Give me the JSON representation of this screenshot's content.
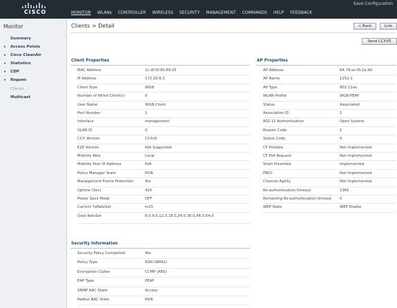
{
  "header": {
    "logo_text": "CISCO",
    "save_config": "Save Configuration",
    "nav": [
      "MONITOR",
      "WLANs",
      "CONTROLLER",
      "WIRELESS",
      "SECURITY",
      "MANAGEMENT",
      "COMMANDS",
      "HELP",
      "FEEDBACK"
    ]
  },
  "sidebar": {
    "title": "Monitor",
    "items": [
      {
        "label": "Summary",
        "arrow": ""
      },
      {
        "label": "Access Points",
        "arrow": "▸"
      },
      {
        "label": "Cisco CleanAir",
        "arrow": "▸"
      },
      {
        "label": "Statistics",
        "arrow": "▸"
      },
      {
        "label": "CDP",
        "arrow": "▸"
      },
      {
        "label": "Rogues",
        "arrow": "▸"
      },
      {
        "label": "Clients",
        "arrow": ""
      },
      {
        "label": "Multicast",
        "arrow": ""
      }
    ]
  },
  "page": {
    "breadcrumb": "Clients > Detail",
    "back_label": "< Back",
    "link_label": "Link",
    "send_label": "Send CCXV5"
  },
  "client": {
    "title": "Client Properties",
    "rows": [
      {
        "k": "MAC Address",
        "v": "1c:df:0f:95:89:25"
      },
      {
        "k": "IP Address",
        "v": "172.20.6.3"
      },
      {
        "k": "Client Type",
        "v": "WGB"
      },
      {
        "k": "Number of Wired Client(s)",
        "v": "0"
      },
      {
        "k": "User Name",
        "v": "WGB-Client"
      },
      {
        "k": "Port Number",
        "v": "1"
      },
      {
        "k": "Interface",
        "v": "management"
      },
      {
        "k": "VLAN ID",
        "v": "0"
      },
      {
        "k": "CCX Version",
        "v": "CCXv5"
      },
      {
        "k": "E2E Version",
        "v": "Not Supported"
      },
      {
        "k": "Mobility Role",
        "v": "Local"
      },
      {
        "k": "Mobility Peer IP Address",
        "v": "N/A"
      },
      {
        "k": "Policy Manager State",
        "v": "RUN"
      },
      {
        "k": "Management Frame Protection",
        "v": "Yes"
      },
      {
        "k": "Uptime (Sec)",
        "v": "420"
      },
      {
        "k": "Power Save Mode",
        "v": "OFF"
      },
      {
        "k": "Current TxRateSet",
        "v": "m15"
      },
      {
        "k": "Data RateSet",
        "v": "6.0,9.0,12.0,18.0,24.0,36.0,48.0,54.0"
      }
    ]
  },
  "ap": {
    "title": "AP Properties",
    "rows": [
      {
        "k": "AP Address",
        "v": "64:79:ac:f0:2a:90"
      },
      {
        "k": "AP Name",
        "v": "1252-1"
      },
      {
        "k": "AP Type",
        "v": "802.11an"
      },
      {
        "k": "WLAN Profile",
        "v": "WGB-PEAP"
      },
      {
        "k": "Status",
        "v": "Associated"
      },
      {
        "k": "Association ID",
        "v": "1"
      },
      {
        "k": "802.11 Authentication",
        "v": "Open System"
      },
      {
        "k": "Reason Code",
        "v": "1"
      },
      {
        "k": "Status Code",
        "v": "0"
      },
      {
        "k": "CF Pollable",
        "v": "Not Implemented"
      },
      {
        "k": "CF Poll Request",
        "v": "Not Implemented"
      },
      {
        "k": "Short Preamble",
        "v": "Implemented"
      },
      {
        "k": "PBCC",
        "v": "Not Implemented"
      },
      {
        "k": "Channel Agility",
        "v": "Not Implemented"
      },
      {
        "k": "Re-authentication timeout",
        "v": "1365"
      },
      {
        "k": "Remaining Re-authentication timeout",
        "v": "0"
      },
      {
        "k": "WEP State",
        "v": "WEP Enable"
      }
    ]
  },
  "security": {
    "title": "Security Information",
    "rows": [
      {
        "k": "Security Policy Completed",
        "v": "Yes"
      },
      {
        "k": "Policy Type",
        "v": "RSN (WPA2)"
      },
      {
        "k": "Encryption Cipher",
        "v": "CCMP (AES)"
      },
      {
        "k": "EAP Type",
        "v": "PEAP"
      },
      {
        "k": "SNMP NAC State",
        "v": "Access"
      },
      {
        "k": "Radius NAC State",
        "v": "RUN"
      }
    ]
  }
}
